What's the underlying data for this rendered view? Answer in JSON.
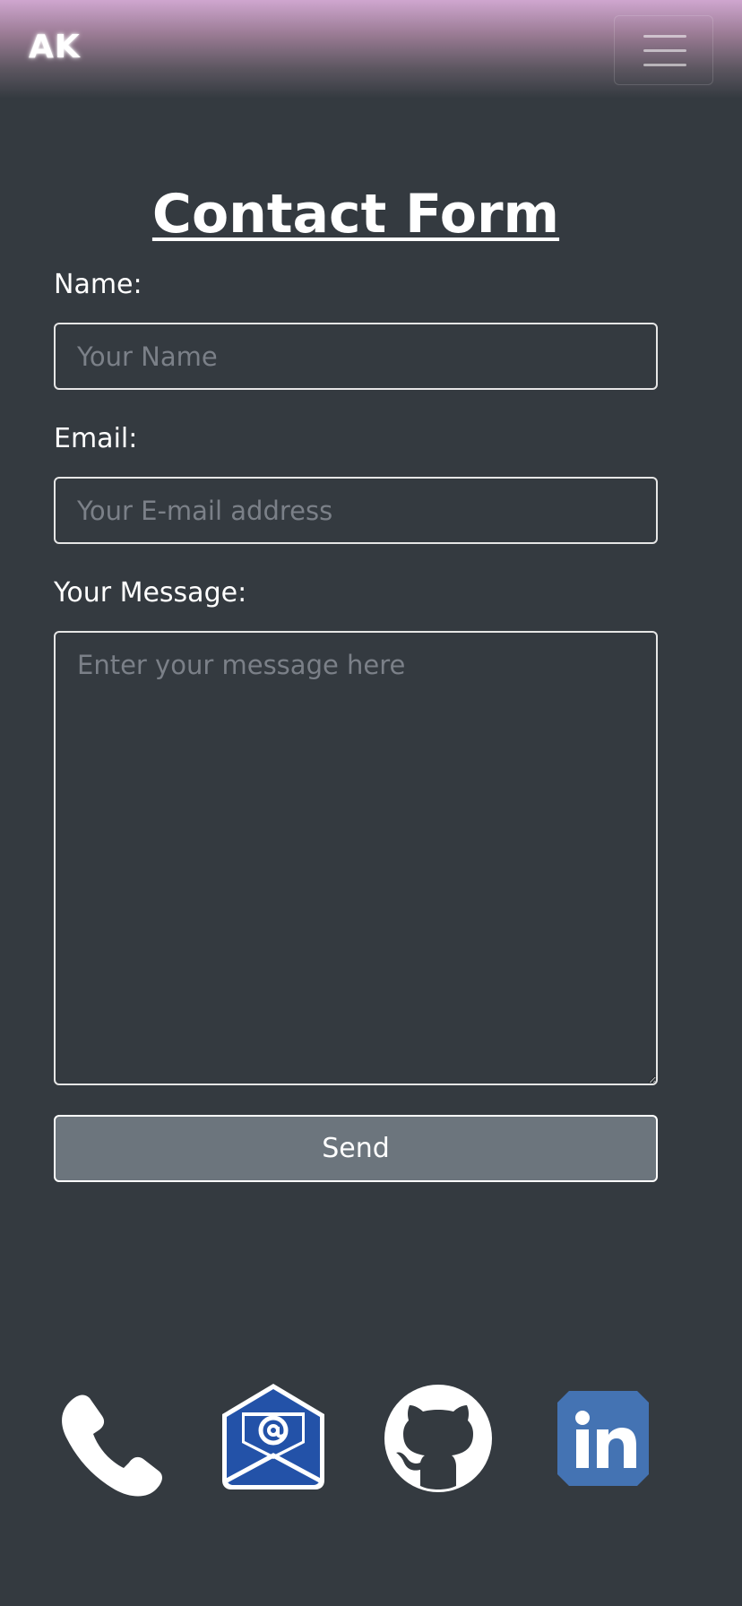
{
  "navbar": {
    "brand": "AK",
    "menu_icon": "hamburger-menu-icon"
  },
  "form": {
    "title": "Contact Form",
    "name_label": "Name:",
    "name_placeholder": "Your Name",
    "name_value": "",
    "email_label": "Email:",
    "email_placeholder": "Your E-mail address",
    "email_value": "",
    "message_label": "Your Message:",
    "message_placeholder": "Enter your message here",
    "message_value": "",
    "send_label": "Send"
  },
  "social": {
    "items": [
      {
        "icon": "phone-icon"
      },
      {
        "icon": "email-icon"
      },
      {
        "icon": "github-icon"
      },
      {
        "icon": "linkedin-icon"
      }
    ]
  },
  "colors": {
    "background": "#343a40",
    "button": "#6c757d",
    "navbar_top": "#cfa6cf",
    "email_blue": "#2352a8",
    "linkedin_blue": "#4473b3"
  }
}
